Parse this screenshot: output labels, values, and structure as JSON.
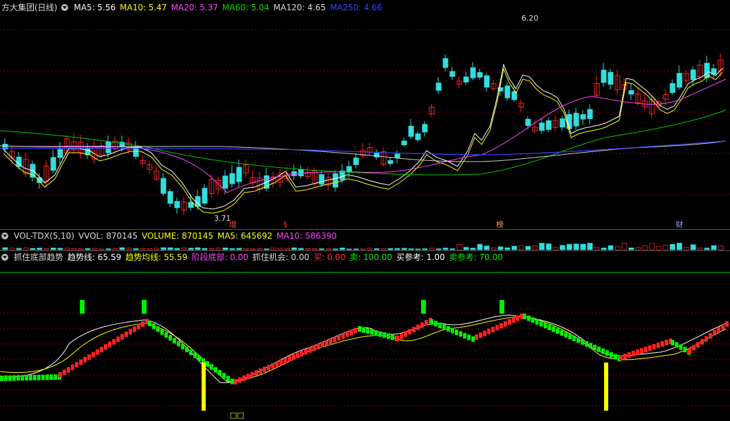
{
  "price_header": {
    "title": "方大集团(日线)",
    "ma_items": [
      {
        "label": "MA5: 5.56",
        "color": "#ffffff"
      },
      {
        "label": "MA10: 5.47",
        "color": "#ffff00"
      },
      {
        "label": "MA20: 5.37",
        "color": "#ff44ff"
      },
      {
        "label": "MA60: 5.04",
        "color": "#00dd00"
      },
      {
        "label": "MA120: 4.65",
        "color": "#dddddd"
      },
      {
        "label": "MA250: 4.66",
        "color": "#3344ff"
      }
    ]
  },
  "volume_header": {
    "title": "VOL-TDX(5,10)",
    "items": [
      {
        "label": "VVOL: 870145",
        "color": "#dddddd"
      },
      {
        "label": "VOLUME: 870145",
        "color": "#ffff00"
      },
      {
        "label": "MA5: 645692",
        "color": "#ffff00"
      },
      {
        "label": "MA10: 586390",
        "color": "#ff44ff"
      }
    ]
  },
  "indicator_header": {
    "title": "抓住底部趋势",
    "items": [
      {
        "label": "趋势线: 65.59",
        "color": "#ffffff"
      },
      {
        "label": "趋势均线: 55.59",
        "color": "#ffff00"
      },
      {
        "label": "阶段底部: 0.00",
        "color": "#ff44ff"
      },
      {
        "label": "抓住机会: 0.00",
        "color": "#dddddd"
      },
      {
        "label": "买: 0.00",
        "color": "#ff3333"
      },
      {
        "label": "卖: 100.00",
        "color": "#00ee00"
      },
      {
        "label": "买参考: 1.00",
        "color": "#ffffff"
      },
      {
        "label": "卖参考: 70.00",
        "color": "#00ee00"
      }
    ]
  },
  "price_annotations": {
    "high_label": "6.20",
    "low_label": "3.71"
  },
  "event_tags": [
    {
      "text": "增",
      "color": "#ff4444"
    },
    {
      "text": "§",
      "color": "#ff3333"
    },
    {
      "text": "榜",
      "color": "#ff9933"
    },
    {
      "text": "财",
      "color": "#88aaff"
    }
  ],
  "bottom_tag": {
    "text": "□□",
    "color": "#ffff00"
  },
  "colors": {
    "up": "#ff2222",
    "down": "#33dddd",
    "grid": "#880000",
    "sell_bar": "#00ee00",
    "bottom_bar": "#ffff00"
  }
}
